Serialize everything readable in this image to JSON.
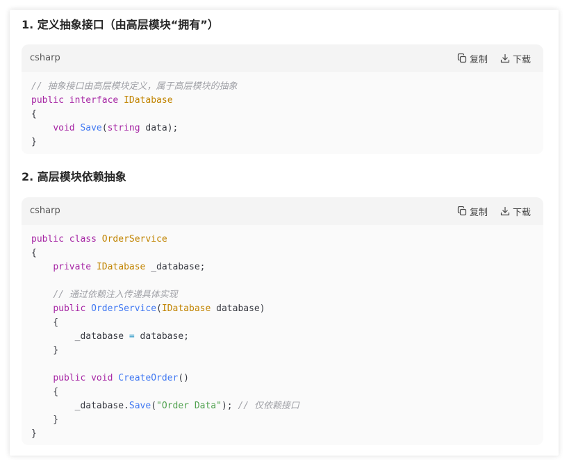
{
  "sections": [
    {
      "heading": "1. 定义抽象接口（由高层模块“拥有”）",
      "code_block": {
        "language": "csharp",
        "copy_label": "复制",
        "download_label": "下载",
        "lines": [
          [
            {
              "t": "// 抽象接口由高层模块定义，属于高层模块的抽象",
              "c": "cm"
            }
          ],
          [
            {
              "t": "public",
              "c": "kw"
            },
            {
              "t": " "
            },
            {
              "t": "interface",
              "c": "kw"
            },
            {
              "t": " "
            },
            {
              "t": "IDatabase",
              "c": "ty"
            }
          ],
          [
            {
              "t": "{"
            }
          ],
          [
            {
              "t": "    "
            },
            {
              "t": "void",
              "c": "kw"
            },
            {
              "t": " "
            },
            {
              "t": "Save",
              "c": "fn"
            },
            {
              "t": "("
            },
            {
              "t": "string",
              "c": "kw"
            },
            {
              "t": " data);"
            }
          ],
          [
            {
              "t": "}"
            }
          ]
        ]
      }
    },
    {
      "heading": "2. 高层模块依赖抽象",
      "code_block": {
        "language": "csharp",
        "copy_label": "复制",
        "download_label": "下载",
        "lines": [
          [
            {
              "t": "public",
              "c": "kw"
            },
            {
              "t": " "
            },
            {
              "t": "class",
              "c": "kw"
            },
            {
              "t": " "
            },
            {
              "t": "OrderService",
              "c": "ty"
            }
          ],
          [
            {
              "t": "{"
            }
          ],
          [
            {
              "t": "    "
            },
            {
              "t": "private",
              "c": "kw"
            },
            {
              "t": " "
            },
            {
              "t": "IDatabase",
              "c": "ty"
            },
            {
              "t": " _database;"
            }
          ],
          [
            {
              "t": ""
            }
          ],
          [
            {
              "t": "    "
            },
            {
              "t": "// 通过依赖注入传递具体实现",
              "c": "cm"
            }
          ],
          [
            {
              "t": "    "
            },
            {
              "t": "public",
              "c": "kw"
            },
            {
              "t": " "
            },
            {
              "t": "OrderService",
              "c": "fn"
            },
            {
              "t": "("
            },
            {
              "t": "IDatabase",
              "c": "ty"
            },
            {
              "t": " database)"
            }
          ],
          [
            {
              "t": "    {"
            }
          ],
          [
            {
              "t": "        _database "
            },
            {
              "t": "=",
              "c": "op"
            },
            {
              "t": " database;"
            }
          ],
          [
            {
              "t": "    }"
            }
          ],
          [
            {
              "t": ""
            }
          ],
          [
            {
              "t": "    "
            },
            {
              "t": "public",
              "c": "kw"
            },
            {
              "t": " "
            },
            {
              "t": "void",
              "c": "kw"
            },
            {
              "t": " "
            },
            {
              "t": "CreateOrder",
              "c": "fn"
            },
            {
              "t": "()"
            }
          ],
          [
            {
              "t": "    {"
            }
          ],
          [
            {
              "t": "        _database."
            },
            {
              "t": "Save",
              "c": "fn"
            },
            {
              "t": "("
            },
            {
              "t": "\"Order Data\"",
              "c": "st"
            },
            {
              "t": "); "
            },
            {
              "t": "// 仅依赖接口",
              "c": "cm"
            }
          ],
          [
            {
              "t": "    }"
            }
          ],
          [
            {
              "t": "}"
            }
          ]
        ]
      }
    }
  ],
  "icons": {
    "copy": "copy-icon",
    "download": "download-icon"
  },
  "colors": {
    "keyword": "#a626a4",
    "type": "#c18401",
    "function": "#4078f2",
    "string": "#50a14f",
    "comment": "#a0a1a7"
  }
}
